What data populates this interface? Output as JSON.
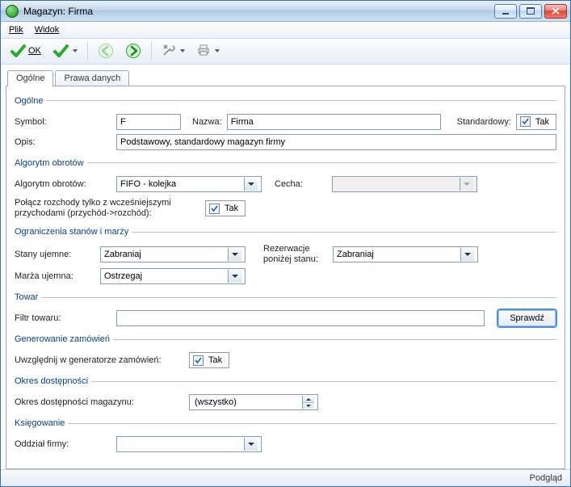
{
  "window": {
    "title": "Magazyn: Firma"
  },
  "menu": {
    "plik": "Plik",
    "widok": "Widok"
  },
  "toolbar": {
    "ok_label": "OK"
  },
  "tabs": {
    "general": "Ogólne",
    "rights": "Prawa danych"
  },
  "status": {
    "preview": "Podgląd"
  },
  "general": {
    "legend": "Ogólne",
    "symbol_label": "Symbol:",
    "symbol_value": "F",
    "name_label": "Nazwa:",
    "name_value": "Firma",
    "standard_label": "Standardowy:",
    "standard_tak": "Tak",
    "desc_label": "Opis:",
    "desc_value": "Podstawowy, standardowy magazyn firmy"
  },
  "algo": {
    "legend": "Algorytm obrotów",
    "algorithm_label": "Algorytm obrotów:",
    "algorithm_value": "FIFO - kolejka",
    "feature_label": "Cecha:",
    "feature_value": "",
    "link_label": "Połącz rozchody tylko z wcześniejszymi przychodami (przychód->rozchód):",
    "link_tak": "Tak"
  },
  "limits": {
    "legend": "Ograniczenia stanów i marży",
    "neg_stock_label": "Stany ujemne:",
    "neg_stock_value": "Zabraniaj",
    "res_below_label": "Rezerwacje poniżej stanu:",
    "res_below_value": "Zabraniaj",
    "neg_margin_label": "Marża ujemna:",
    "neg_margin_value": "Ostrzegaj"
  },
  "goods": {
    "legend": "Towar",
    "filter_label": "Filtr towaru:",
    "filter_value": "",
    "check_button": "Sprawdź"
  },
  "orders": {
    "legend": "Generowanie zamówień",
    "include_label": "Uwzględnij w generatorze zamówień:",
    "include_tak": "Tak"
  },
  "availability": {
    "legend": "Okres dostępności",
    "period_label": "Okres dostępności magazynu:",
    "period_value": "(wszystko)"
  },
  "booking": {
    "legend": "Księgowanie",
    "branch_label": "Oddział firmy:",
    "branch_value": ""
  }
}
